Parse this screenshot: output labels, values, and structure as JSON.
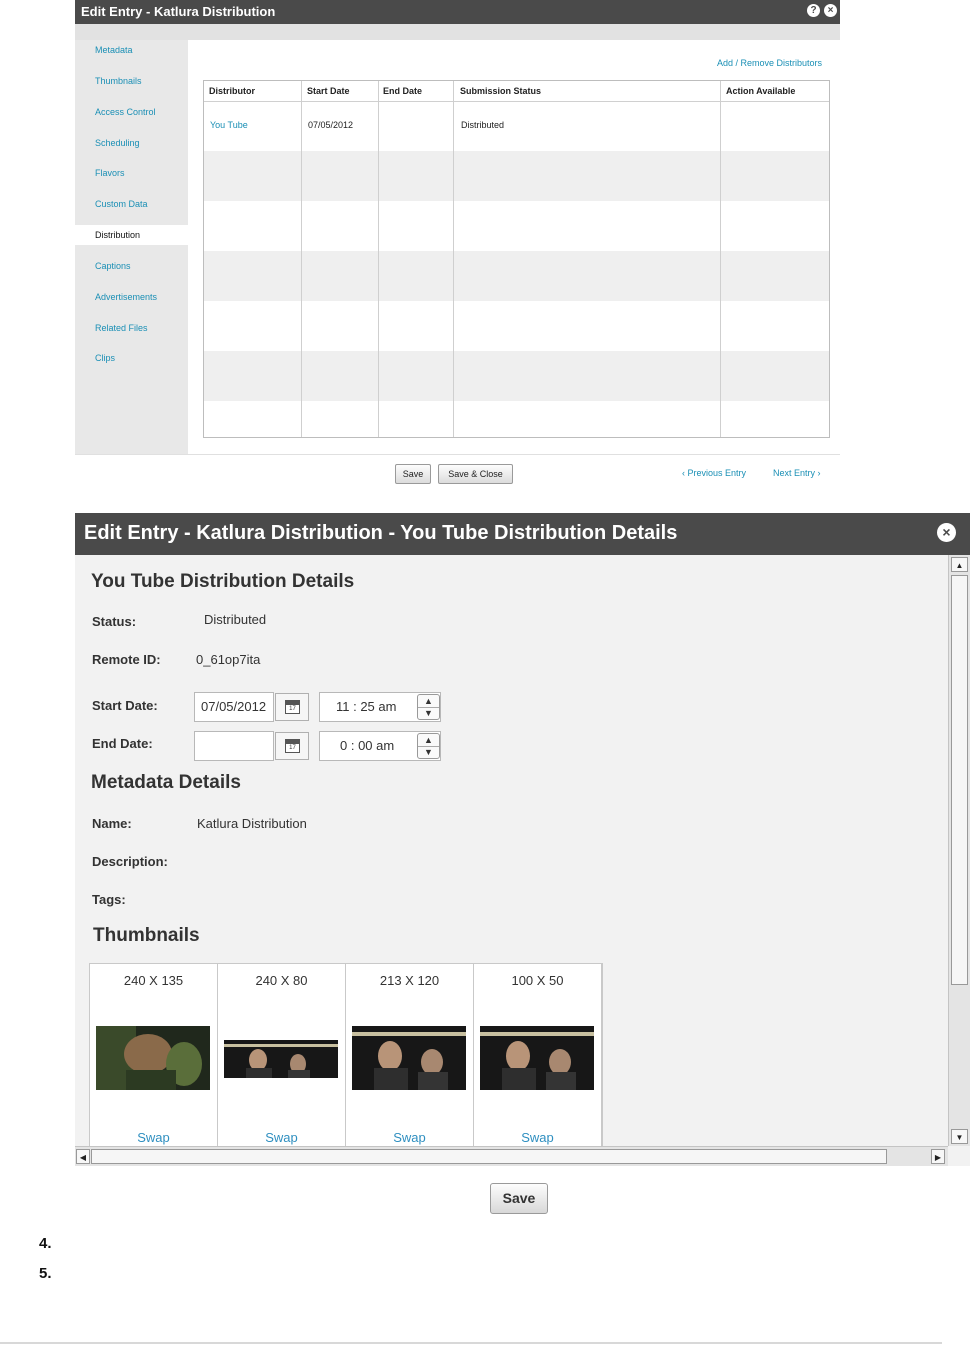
{
  "top_dialog": {
    "title": "Edit Entry - Katlura Distribution",
    "help_icon": "?",
    "close_icon": "×",
    "sidebar": [
      "Metadata",
      "Thumbnails",
      "Access Control",
      "Scheduling",
      "Flavors",
      "Custom Data",
      "Distribution",
      "Captions",
      "Advertisements",
      "Related Files",
      "Clips"
    ],
    "active_tab": "Distribution",
    "add_remove_link": "Add / Remove Distributors",
    "columns": [
      "Distributor",
      "Start Date",
      "End Date",
      "Submission Status",
      "Action Available"
    ],
    "rows": [
      {
        "distributor": "You Tube",
        "start_date": "07/05/2012",
        "end_date": "",
        "status": "Distributed",
        "action": ""
      }
    ],
    "buttons": {
      "save": "Save",
      "save_close": "Save & Close"
    },
    "nav": {
      "previous": "‹ Previous Entry",
      "next": "Next Entry ›"
    }
  },
  "bottom_dialog": {
    "title": "Edit Entry - Katlura Distribution - You Tube Distribution Details",
    "close_icon": "×",
    "section_title": "You Tube Distribution Details",
    "status_label": "Status:",
    "status_value": "Distributed",
    "remote_id_label": "Remote ID:",
    "remote_id_value": "0_61op7ita",
    "start_date_label": "Start Date:",
    "start_date_value": "07/05/2012",
    "start_time": "11 : 25   am",
    "end_date_label": "End Date:",
    "end_date_value": "",
    "end_time": "0 : 00   am",
    "calendar_day": "17",
    "metadata_title": "Metadata Details",
    "name_label": "Name:",
    "name_value": "Katlura Distribution",
    "description_label": "Description:",
    "tags_label": "Tags:",
    "thumbnails_title": "Thumbnails",
    "thumbnails": [
      {
        "dim": "240 X 135",
        "swap": "Swap"
      },
      {
        "dim": "240 X 80",
        "swap": "Swap"
      },
      {
        "dim": "213 X 120",
        "swap": "Swap"
      },
      {
        "dim": "100 X 50",
        "swap": "Swap"
      }
    ],
    "save_button": "Save"
  },
  "list_items": [
    "4.",
    "5."
  ],
  "colors": {
    "title_bar": "#4a4a4a",
    "link": "#1a8fb5",
    "sidebar_bg": "#e8e8e8",
    "dialog_bg": "#f2f2f2"
  }
}
